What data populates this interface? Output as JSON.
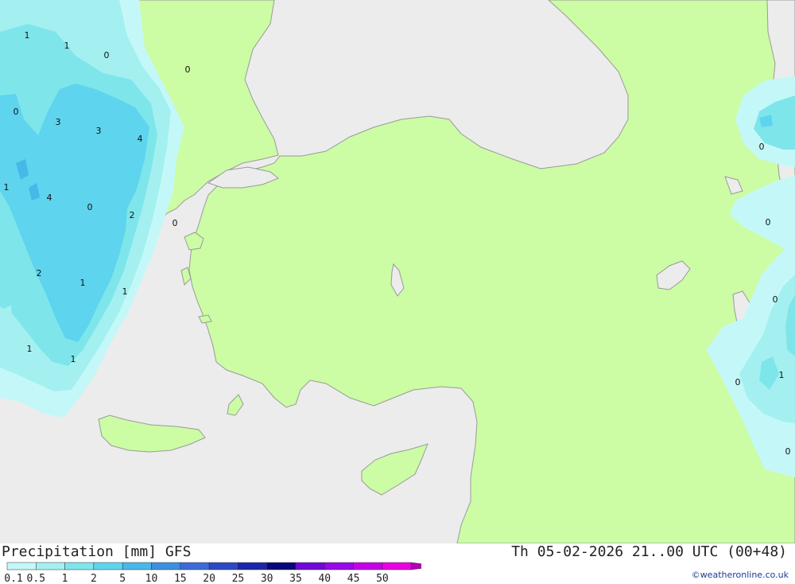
{
  "title": {
    "left": "Precipitation [mm] GFS",
    "right": "Th 05-02-2026 21..00 UTC (00+48)"
  },
  "copyright": "©weatheronline.co.uk",
  "colors": {
    "sea": "#ececec",
    "land": "#ccfca4",
    "coast": "#9a9a9a",
    "precip_0_1": "#c4f8f8",
    "precip_0_5": "#a4f0f0",
    "precip_1": "#7ee6ea",
    "precip_2": "#5ed4ee",
    "precip_5": "#48b8e8"
  },
  "legend": {
    "labels": [
      "0.1",
      "0.5",
      "1",
      "2",
      "5",
      "10",
      "15",
      "20",
      "25",
      "30",
      "35",
      "40",
      "45",
      "50"
    ],
    "colors": [
      "#c4f8f8",
      "#a4f0f0",
      "#7ee6ea",
      "#5ed4ee",
      "#48b8e8",
      "#3c90e0",
      "#3c6ad8",
      "#2c48c4",
      "#1c24ac",
      "#08087c",
      "#7008d8",
      "#9808e8",
      "#c400e8",
      "#e800e0",
      "#b000b0"
    ]
  },
  "contour_labels": [
    "1",
    "1",
    "0",
    "0",
    "0",
    "3",
    "3",
    "4",
    "1",
    "4",
    "0",
    "2",
    "0",
    "2",
    "1",
    "1",
    "1",
    "1",
    "0",
    "0",
    "0",
    "0",
    "1",
    "0"
  ]
}
